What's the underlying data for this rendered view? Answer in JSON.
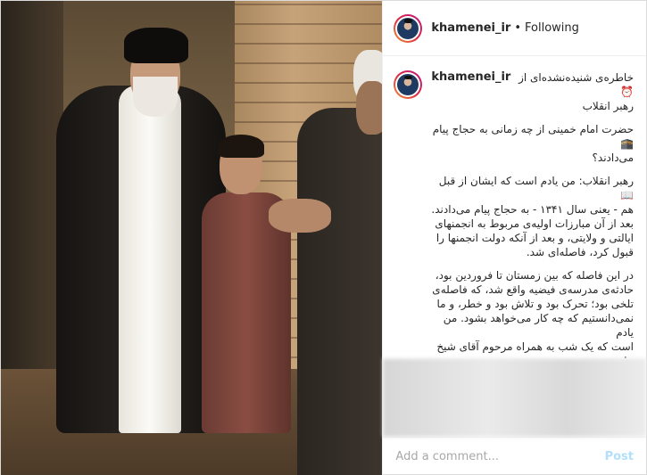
{
  "header": {
    "username": "khamenei_ir",
    "separator": "•",
    "follow_status": "Following"
  },
  "caption": {
    "username": "khamenei_ir",
    "title": "خاطره‌ی شنیده‌نشده‌ای از⏰\nرهبر انقلاب",
    "question": "حضرت امام خمینی از چه زمانی به حجاج پیام🕋\nمی‌دادند؟",
    "paragraph1": "رهبر انقلاب: من یادم است که ایشان از قبل📖\nهم - یعنی سال ۱۳۴۱ - به حجاج پیام می‌دادند.\nبعد از آن مبارزات اولیه‌ی مربوط به انجمنهای\nایالتی و ولایتی، و بعد از آنکه دولت انجمنها را\nقبول کرد، فاصله‌ای شد.",
    "paragraph2": "در این فاصله که بین زمستان تا فروردین بود،\nحادثه‌ی مدرسه‌ی فیضیه واقع شد، که فاصله‌ی\nتلخی بود؛ تحرک بود و تلاش بود و خطر، و ما\nنمی‌دانستیم که چه کار می‌خواهد بشود. من یادم\nاست که یک شب به همراه مرحوم آقای شیخ علی\nحیدری نهاوندی - از شهدای حزب جمهوری\nاسلامی - و دو نفر دیگر خدمت امام رفتیم، تا"
  },
  "comment": {
    "placeholder": "Add a comment...",
    "post_label": "Post"
  }
}
